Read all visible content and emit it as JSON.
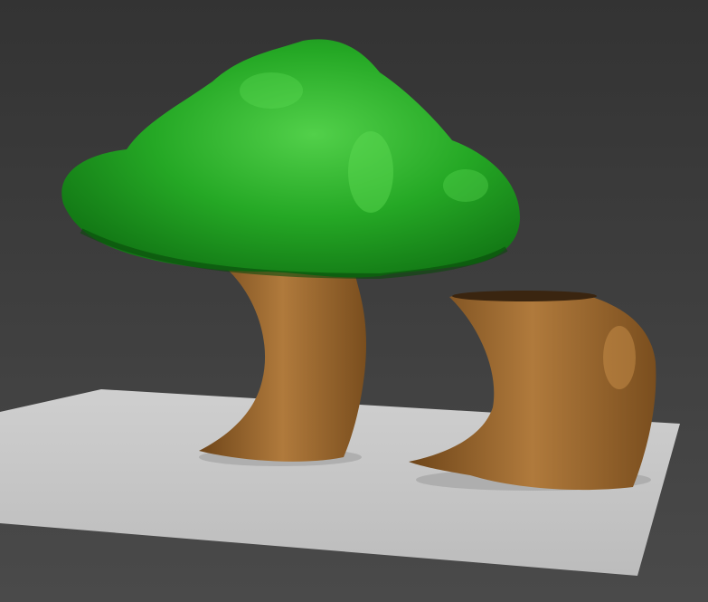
{
  "colors": {
    "background_top": "#333333",
    "background_bottom": "#4a4a4a",
    "ground_plane": "#c4c4c4",
    "canopy": "#1f9a1f",
    "canopy_highlight": "#52d04a",
    "trunk": "#8a5a26",
    "trunk_highlight": "#b07a3c"
  }
}
